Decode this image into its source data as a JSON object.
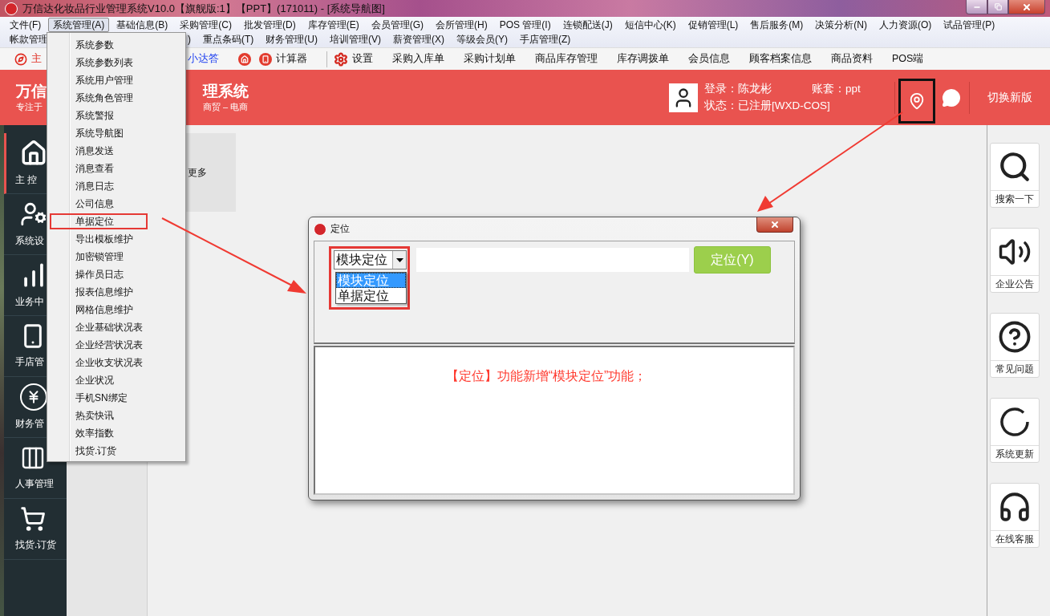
{
  "window": {
    "title": "万信达化妆品行业管理系统V10.0【旗舰版:1】【PPT】(171011) - [系统导航图]"
  },
  "menu_bar": {
    "row_1": [
      {
        "label": "文件(F)",
        "selected": false
      },
      {
        "label": "系统管理(A)",
        "selected": true
      },
      {
        "label": "基础信息(B)",
        "selected": false
      },
      {
        "label": "采购管理(C)",
        "selected": false
      },
      {
        "label": "批发管理(D)",
        "selected": false
      },
      {
        "label": "库存管理(E)",
        "selected": false
      },
      {
        "label": "会员管理(G)",
        "selected": false
      },
      {
        "label": "会所管理(H)",
        "selected": false
      },
      {
        "label": "POS 管理(I)",
        "selected": false
      },
      {
        "label": "连锁配送(J)",
        "selected": false
      },
      {
        "label": "短信中心(K)",
        "selected": false
      },
      {
        "label": "促销管理(L)",
        "selected": false
      },
      {
        "label": "售后服务(M)",
        "selected": false
      },
      {
        "label": "决策分析(N)",
        "selected": false
      },
      {
        "label": "人力资源(O)",
        "selected": false
      },
      {
        "label": "试品管理(P)",
        "selected": false
      }
    ],
    "row_2": [
      {
        "label": "帐款管理",
        "selected": false
      },
      {
        "label": ")",
        "selected": false
      },
      {
        "label": "重点条码(T)",
        "selected": false
      },
      {
        "label": "财务管理(U)",
        "selected": false
      },
      {
        "label": "培训管理(V)",
        "selected": false
      },
      {
        "label": "薪资管理(X)",
        "selected": false
      },
      {
        "label": "等级会员(Y)",
        "selected": false
      },
      {
        "label": "手店管理(Z)",
        "selected": false
      }
    ]
  },
  "toolbar": [
    {
      "kind": "home-link",
      "label": "主"
    },
    {
      "kind": "help-link",
      "label": "小达答"
    },
    {
      "kind": "home"
    },
    {
      "kind": "calculator",
      "label": "计算器"
    },
    {
      "kind": "settings",
      "label": "设置"
    },
    {
      "kind": "plain",
      "label": "采购入库单"
    },
    {
      "kind": "plain",
      "label": "采购计划单"
    },
    {
      "kind": "plain",
      "label": "商品库存管理"
    },
    {
      "kind": "plain",
      "label": "库存调拨单"
    },
    {
      "kind": "plain",
      "label": "会员信息"
    },
    {
      "kind": "plain",
      "label": "顾客档案信息"
    },
    {
      "kind": "plain",
      "label": "商品资料"
    },
    {
      "kind": "plain",
      "label": "POS端"
    }
  ],
  "header": {
    "brand_left": "万信",
    "tagline_left": "专注于",
    "brand_right": "理系统",
    "tagline_right": "商贸 – 电商",
    "login": "登录：陈龙彬",
    "account": "账套：ppt",
    "status": "状态：已注册[WXD-COS]",
    "location_marked": true,
    "switch_label": "切换新版"
  },
  "sidebar": {
    "items": [
      {
        "label": "主 控",
        "selected": true
      },
      {
        "label": "系统设",
        "selected": false
      },
      {
        "label": "业务中",
        "selected": false
      },
      {
        "label": "手店管",
        "selected": false
      },
      {
        "label": "财务管",
        "selected": false
      },
      {
        "label": "人事管理",
        "selected": false
      },
      {
        "label": "找货.订货",
        "selected": false
      }
    ]
  },
  "main": {
    "card_label": "更多"
  },
  "right_panel": [
    {
      "label": "搜索一下"
    },
    {
      "label": "企业公告"
    },
    {
      "label": "常见问题"
    },
    {
      "label": "系统更新"
    },
    {
      "label": "在线客服"
    }
  ],
  "system_menu": {
    "items": [
      {
        "label": "系统参数",
        "marked": false
      },
      {
        "label": "系统参数列表",
        "marked": false
      },
      {
        "label": "系统用户管理",
        "marked": false
      },
      {
        "label": "系统角色管理",
        "marked": false
      },
      {
        "label": "系统警报",
        "marked": false
      },
      {
        "label": "系统导航图",
        "marked": false
      },
      {
        "label": "消息发送",
        "marked": false
      },
      {
        "label": "消息查看",
        "marked": false
      },
      {
        "label": "消息日志",
        "marked": false
      },
      {
        "label": "公司信息",
        "marked": false
      },
      {
        "label": "单据定位",
        "marked": true
      },
      {
        "label": "导出模板维护",
        "marked": false
      },
      {
        "label": "加密锁管理",
        "marked": false
      },
      {
        "label": "操作员日志",
        "marked": false
      },
      {
        "label": "报表信息维护",
        "marked": false
      },
      {
        "label": "网格信息维护",
        "marked": false
      },
      {
        "label": "企业基础状况表",
        "marked": false
      },
      {
        "label": "企业经营状况表",
        "marked": false
      },
      {
        "label": "企业收支状况表",
        "marked": false
      },
      {
        "label": "企业状况",
        "marked": false
      },
      {
        "label": "手机SN绑定",
        "marked": false
      },
      {
        "label": "热卖快讯",
        "marked": false
      },
      {
        "label": "效率指数",
        "marked": false
      },
      {
        "label": "找货.订货",
        "marked": false
      }
    ]
  },
  "dialog": {
    "title": "定位",
    "combo": {
      "value": "模块定位",
      "expanded": true,
      "marked": true,
      "options": [
        {
          "label": "模块定位",
          "selected": true
        },
        {
          "label": "单据定位",
          "selected": false
        }
      ]
    },
    "button": "定位(Y)",
    "note": "【定位】功能新增“模块定位”功能；"
  }
}
